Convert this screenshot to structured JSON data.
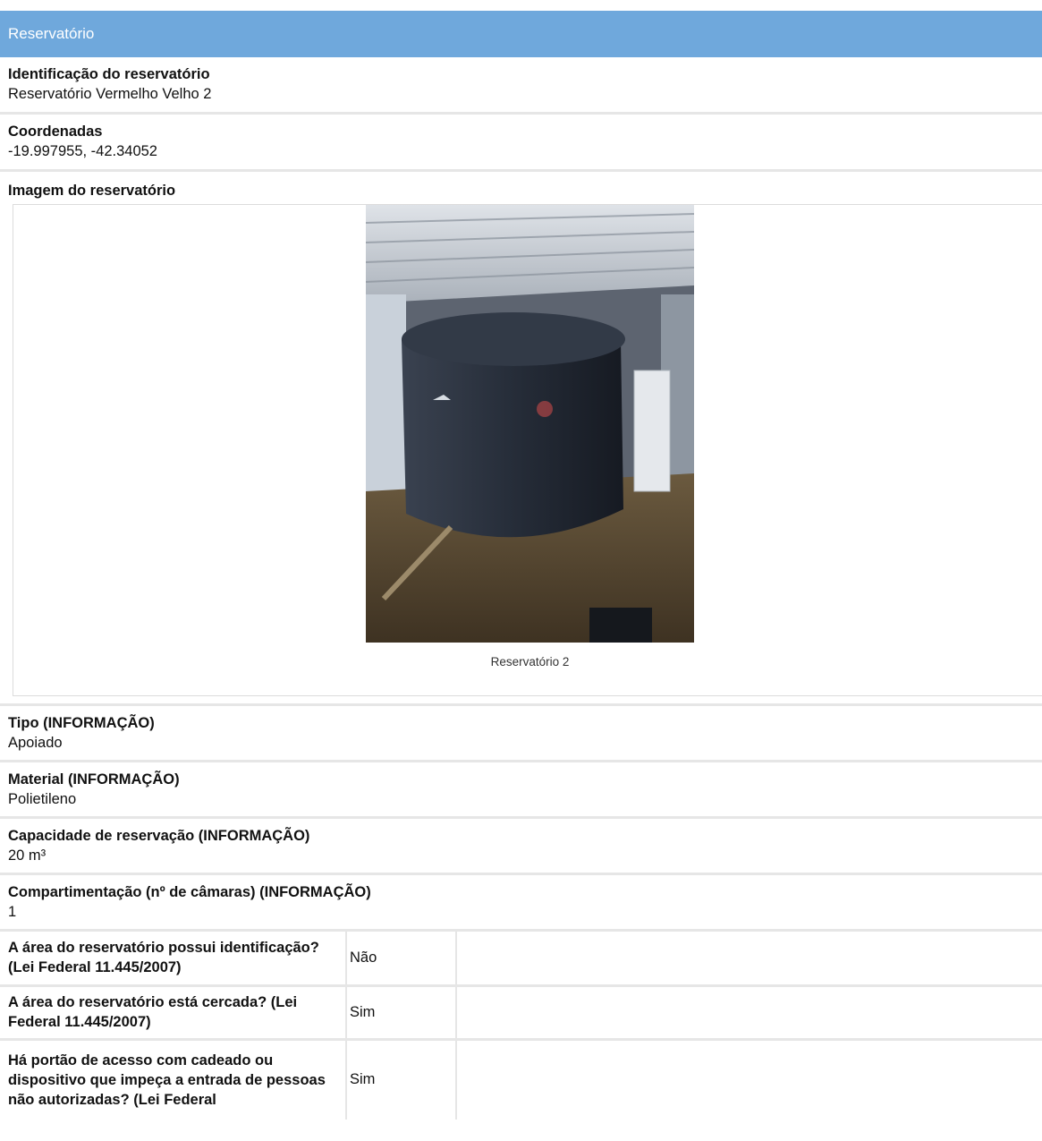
{
  "section": {
    "title": "Reservatório"
  },
  "fields": [
    {
      "label": "Identificação do reservatório",
      "value": "Reservatório Vermelho Velho 2"
    },
    {
      "label": "Coordenadas",
      "value": "-19.997955, -42.34052"
    }
  ],
  "image": {
    "label": "Imagem do reservatório",
    "caption": "Reservatório 2"
  },
  "info_fields": [
    {
      "label": "Tipo (INFORMAÇÃO)",
      "value": "Apoiado"
    },
    {
      "label": "Material (INFORMAÇÃO)",
      "value": "Polietileno"
    },
    {
      "label": "Capacidade de reservação (INFORMAÇÃO)",
      "value": "20 m³"
    },
    {
      "label": "Compartimentação (nº de câmaras) (INFORMAÇÃO)",
      "value": "1"
    }
  ],
  "questions": [
    {
      "question": "A área do reservatório possui identificação? (Lei Federal 11.445/2007)",
      "answer": "Não"
    },
    {
      "question": "A área do reservatório está cercada? (Lei Federal 11.445/2007)",
      "answer": "Sim"
    },
    {
      "question": "Há portão de acesso com cadeado ou dispositivo que impeça a entrada de pessoas não autorizadas? (Lei Federal",
      "answer": "Sim"
    }
  ],
  "colors": {
    "header": "#6fa8dc",
    "divider": "#e6e6e6",
    "tank": "#2a3140"
  }
}
